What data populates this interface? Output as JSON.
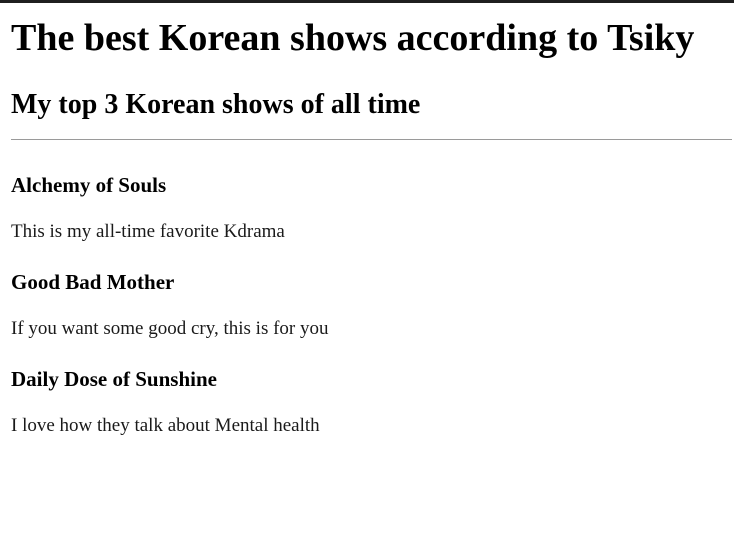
{
  "page": {
    "title": "The best Korean shows according to Tsiky",
    "subtitle": "My top 3 Korean shows of all time"
  },
  "shows": [
    {
      "title": "Alchemy of Souls",
      "description": "This is my all-time favorite Kdrama"
    },
    {
      "title": "Good Bad Mother",
      "description": "If you want some good cry, this is for you"
    },
    {
      "title": "Daily Dose of Sunshine",
      "description": "I love how they talk about Mental health"
    }
  ]
}
